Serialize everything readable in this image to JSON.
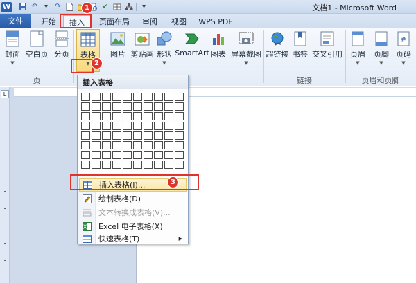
{
  "window": {
    "title": "文档1 - Microsoft Word"
  },
  "tabs": [
    {
      "label": "文件"
    },
    {
      "label": "开始"
    },
    {
      "label": "插入"
    },
    {
      "label": "页面布局"
    },
    {
      "label": "审阅"
    },
    {
      "label": "视图"
    },
    {
      "label": "WPS PDF"
    }
  ],
  "ribbon": {
    "buttons": [
      {
        "label": "封面"
      },
      {
        "label": "空白页"
      },
      {
        "label": "分页"
      },
      {
        "label": "表格"
      },
      {
        "label": "图片"
      },
      {
        "label": "剪贴画"
      },
      {
        "label": "形状"
      },
      {
        "label": "SmartArt"
      },
      {
        "label": "图表"
      },
      {
        "label": "屏幕截图"
      },
      {
        "label": "超链接"
      },
      {
        "label": "书签"
      },
      {
        "label": "交叉引用"
      },
      {
        "label": "页眉"
      },
      {
        "label": "页脚"
      },
      {
        "label": "页码"
      }
    ],
    "groups": [
      {
        "label": "页"
      },
      {
        "label": "链接"
      },
      {
        "label": "页眉和页脚"
      }
    ]
  },
  "dropdown": {
    "header": "插入表格",
    "grid_rows": 8,
    "grid_cols": 10,
    "items": [
      {
        "label": "插入表格(I)...",
        "state": "hover"
      },
      {
        "label": "绘制表格(D)",
        "state": "enabled"
      },
      {
        "label": "文本转换成表格(V)...",
        "state": "disabled"
      },
      {
        "label": "Excel 电子表格(X)",
        "state": "enabled"
      },
      {
        "label": "快速表格(T)",
        "state": "enabled"
      }
    ]
  },
  "annotations": [
    {
      "label": "1"
    },
    {
      "label": "2"
    },
    {
      "label": "3"
    }
  ],
  "colors": {
    "accent": "#2b5fad",
    "annotation": "#e0332c",
    "hover_fill": "#fbe6a3"
  }
}
